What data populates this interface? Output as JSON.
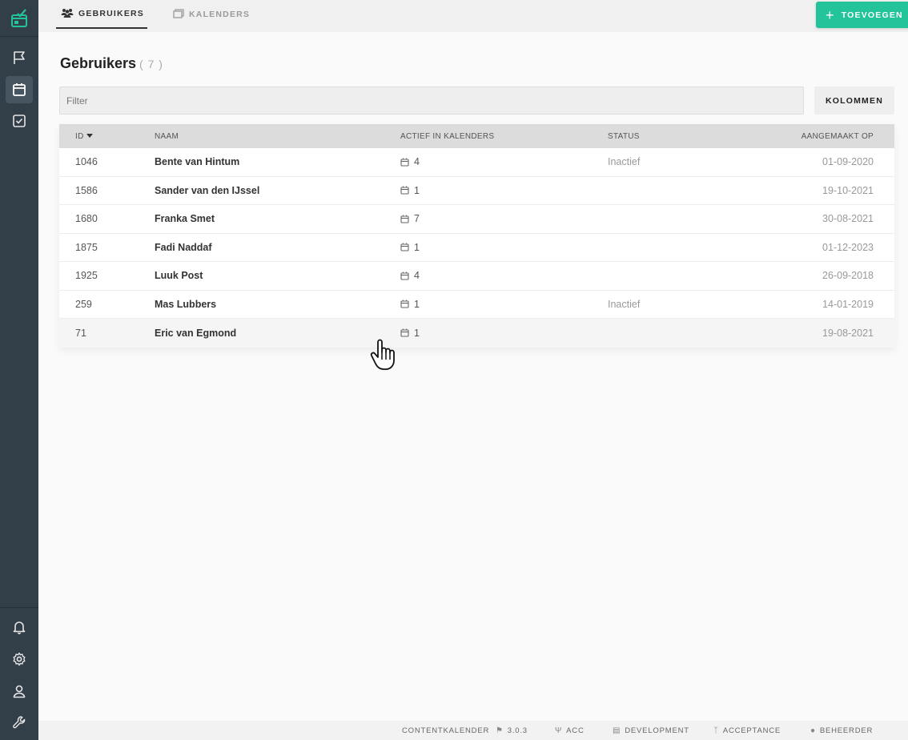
{
  "tabs": [
    {
      "label": "GEBRUIKERS",
      "icon": "users-icon",
      "active": true
    },
    {
      "label": "KALENDERS",
      "icon": "calendars-icon",
      "active": false
    }
  ],
  "add_button": {
    "label": "TOEVOEGEN"
  },
  "page": {
    "title": "Gebruikers",
    "count": "( 7 )"
  },
  "filter": {
    "placeholder": "Filter",
    "value": ""
  },
  "columns_button": {
    "label": "KOLOMMEN"
  },
  "table": {
    "headers": {
      "id": "ID",
      "name": "NAAM",
      "active": "ACTIEF IN KALENDERS",
      "status": "STATUS",
      "created": "AANGEMAAKT OP"
    },
    "rows": [
      {
        "id": "1046",
        "name": "Bente van Hintum",
        "active": "4",
        "status": "Inactief",
        "created": "01-09-2020"
      },
      {
        "id": "1586",
        "name": "Sander van den IJssel",
        "active": "1",
        "status": "",
        "created": "19-10-2021"
      },
      {
        "id": "1680",
        "name": "Franka Smet",
        "active": "7",
        "status": "",
        "created": "30-08-2021"
      },
      {
        "id": "1875",
        "name": "Fadi Naddaf",
        "active": "1",
        "status": "",
        "created": "01-12-2023"
      },
      {
        "id": "1925",
        "name": "Luuk Post",
        "active": "4",
        "status": "",
        "created": "26-09-2018"
      },
      {
        "id": "259",
        "name": "Mas Lubbers",
        "active": "1",
        "status": "Inactief",
        "created": "14-01-2019"
      },
      {
        "id": "71",
        "name": "Eric van Egmond",
        "active": "1",
        "status": "",
        "created": "19-08-2021"
      }
    ]
  },
  "footer": {
    "app": "CONTENTKALENDER",
    "version": "3.0.3",
    "env": "ACC",
    "database": "DEVELOPMENT",
    "branch": "ACCEPTANCE",
    "role": "BEHEERDER"
  },
  "colors": {
    "accent": "#23c49a",
    "sidebar": "#323f48",
    "topbar": "#f0f0f0"
  }
}
